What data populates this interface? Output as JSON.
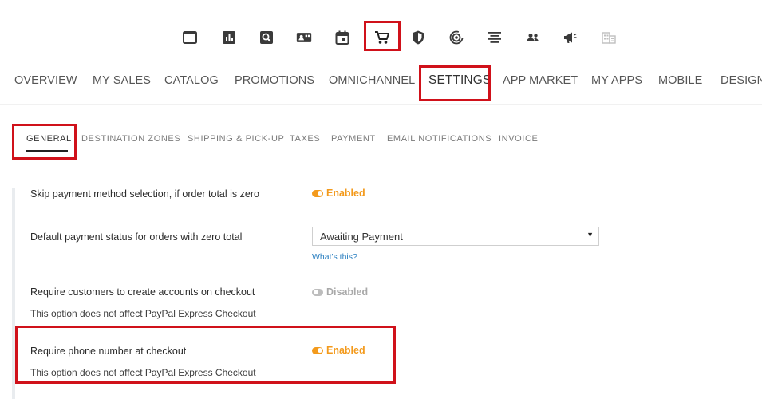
{
  "icon_bar": {
    "icons": [
      {
        "name": "dashboard-window-icon"
      },
      {
        "name": "reports-chart-icon"
      },
      {
        "name": "search-icon"
      },
      {
        "name": "customer-card-icon"
      },
      {
        "name": "calendar-icon"
      },
      {
        "name": "shopping-cart-icon",
        "highlighted": true
      },
      {
        "name": "security-shield-icon"
      },
      {
        "name": "signal-radar-icon"
      },
      {
        "name": "align-text-icon"
      },
      {
        "name": "users-icon"
      },
      {
        "name": "megaphone-icon"
      },
      {
        "name": "building-grid-icon"
      }
    ]
  },
  "main_nav": {
    "items": [
      {
        "label": "OVERVIEW"
      },
      {
        "label": "MY SALES"
      },
      {
        "label": "CATALOG"
      },
      {
        "label": "PROMOTIONS"
      },
      {
        "label": "OMNICHANNEL"
      },
      {
        "label": "SETTINGS",
        "active": true
      },
      {
        "label": "APP MARKET"
      },
      {
        "label": "MY APPS"
      },
      {
        "label": "MOBILE"
      },
      {
        "label": "DESIGN"
      }
    ]
  },
  "sub_nav": {
    "items": [
      {
        "label": "GENERAL",
        "active": true
      },
      {
        "label": "DESTINATION ZONES"
      },
      {
        "label": "SHIPPING & PICK-UP"
      },
      {
        "label": "TAXES"
      },
      {
        "label": "PAYMENT"
      },
      {
        "label": "EMAIL NOTIFICATIONS"
      },
      {
        "label": "INVOICE"
      }
    ]
  },
  "settings": {
    "skip_payment": {
      "label": "Skip payment method selection, if order total is zero",
      "status": "Enabled"
    },
    "default_payment_status": {
      "label": "Default payment status for orders with zero total",
      "selected": "Awaiting Payment",
      "help_link": "What's this?"
    },
    "require_accounts": {
      "label": "Require customers to create accounts on checkout",
      "note": "This option does not affect PayPal Express Checkout",
      "status": "Disabled"
    },
    "require_phone": {
      "label": "Require phone number at checkout",
      "note": "This option does not affect PayPal Express Checkout",
      "status": "Enabled"
    }
  },
  "colors": {
    "enabled": "#f39a1c",
    "disabled": "#a9a9a9",
    "highlight": "#d0111a",
    "link": "#2a7fc0"
  }
}
